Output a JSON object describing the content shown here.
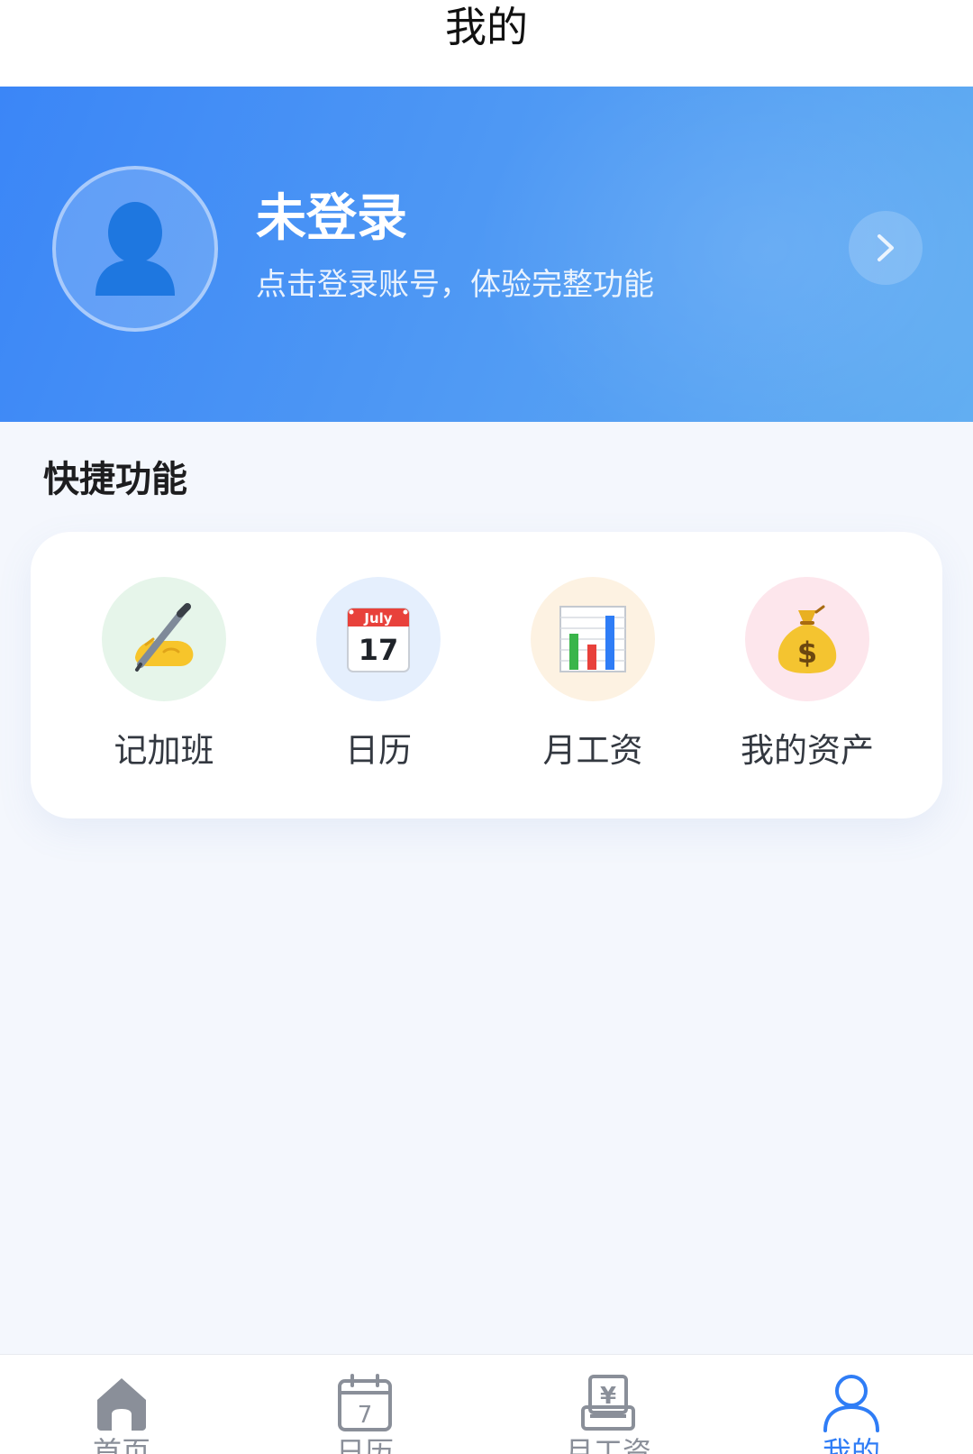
{
  "header": {
    "title": "我的"
  },
  "profile": {
    "title": "未登录",
    "subtitle": "点击登录账号，体验完整功能"
  },
  "quick": {
    "section_title": "快捷功能",
    "items": [
      {
        "label": "记加班",
        "icon": "writing-hand-icon",
        "bg": "#e6f5ea"
      },
      {
        "label": "日历",
        "icon": "calendar-icon",
        "bg": "#e5effd",
        "calendar_month": "July",
        "calendar_day": "17"
      },
      {
        "label": "月工资",
        "icon": "bar-chart-icon",
        "bg": "#fdf2e2"
      },
      {
        "label": "我的资产",
        "icon": "money-bag-icon",
        "bg": "#fde6ec"
      }
    ]
  },
  "tabbar": {
    "items": [
      {
        "label": "首页",
        "icon": "home-icon",
        "active": false
      },
      {
        "label": "日历",
        "icon": "calendar-tab-icon",
        "active": false,
        "day": "7"
      },
      {
        "label": "月工资",
        "icon": "salary-icon",
        "active": false,
        "symbol": "¥"
      },
      {
        "label": "我的",
        "icon": "profile-icon",
        "active": true
      }
    ]
  },
  "colors": {
    "accent": "#2f7df6",
    "header_start": "#3b86f7",
    "header_end": "#62aef2",
    "background": "#f4f7fd"
  }
}
